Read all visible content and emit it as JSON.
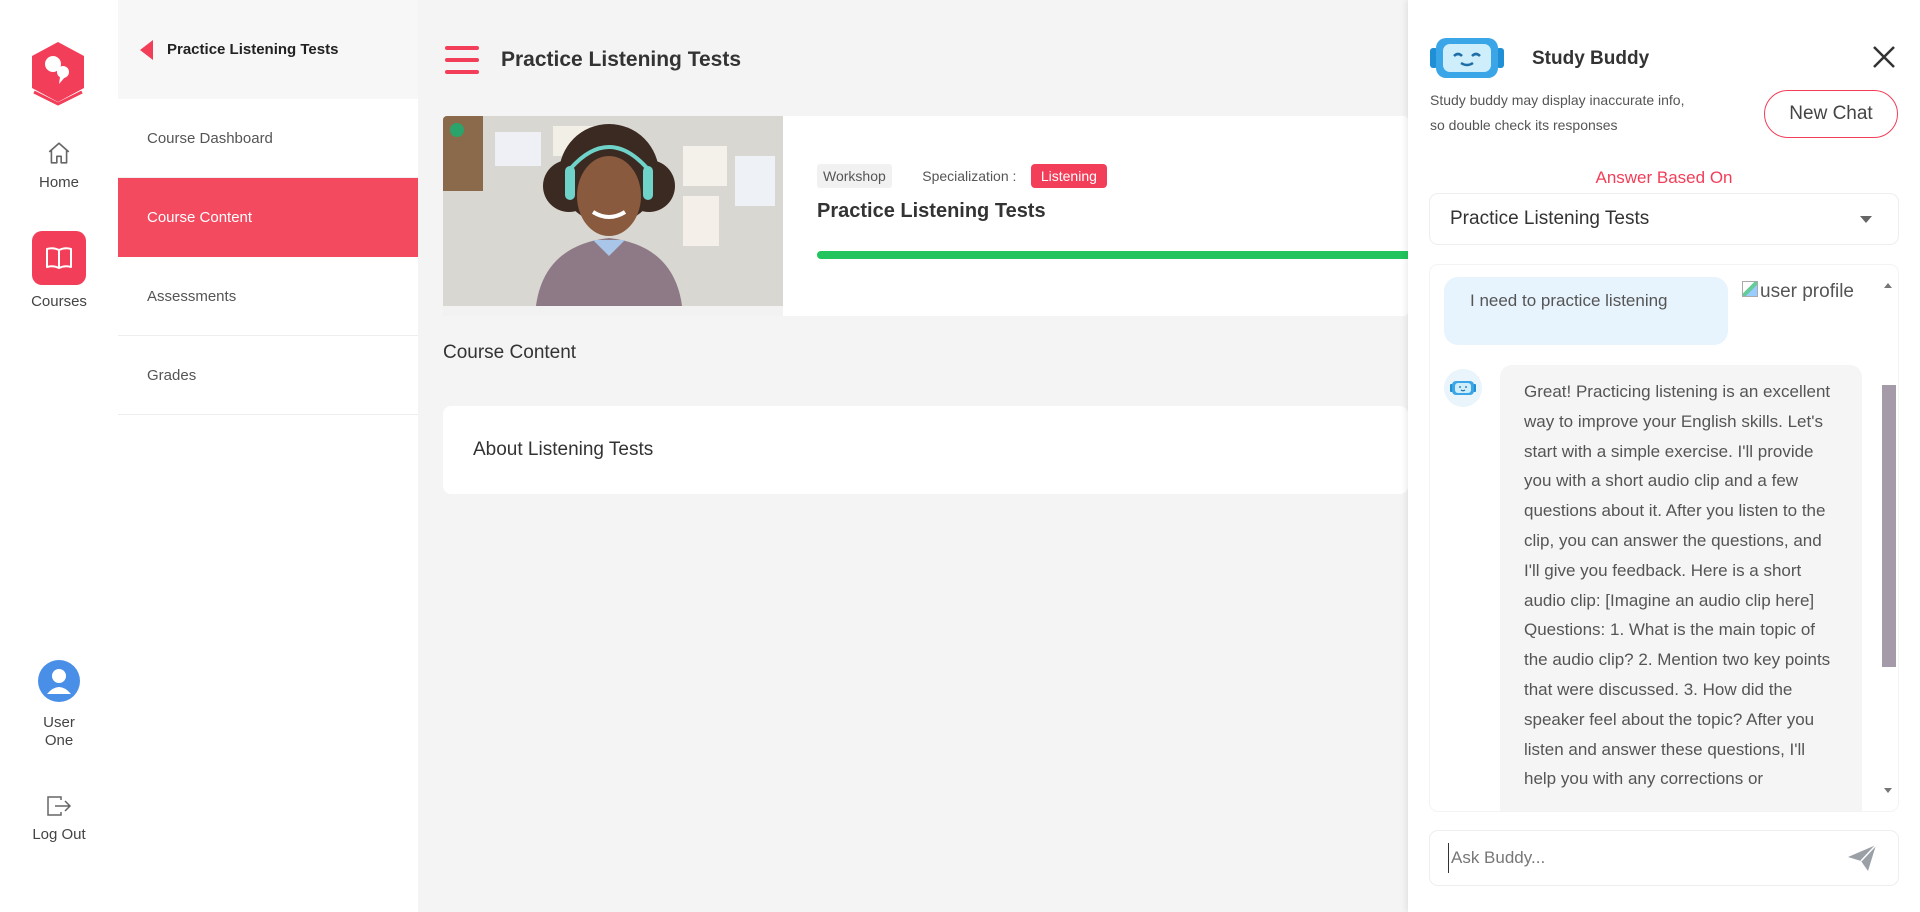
{
  "rail": {
    "home_label": "Home",
    "courses_label": "Courses",
    "user_label_line1": "User",
    "user_label_line2": "One",
    "logout_label": "Log Out",
    "accent": "#f23e58"
  },
  "sidebar": {
    "title": "Practice Listening Tests",
    "items": [
      {
        "label": "Course Dashboard",
        "active": false
      },
      {
        "label": "Course Content",
        "active": true
      },
      {
        "label": "Assessments",
        "active": false
      },
      {
        "label": "Grades",
        "active": false
      }
    ]
  },
  "main": {
    "page_title": "Practice Listening Tests",
    "course": {
      "tag": "Workshop",
      "specialization_label": "Specialization :",
      "specialization": "Listening",
      "title": "Practice Listening Tests",
      "progress_fraction": 1.0,
      "progress_color": "#22c45e"
    },
    "section_title": "Course Content",
    "about_title": "About Listening Tests"
  },
  "buddy": {
    "title": "Study Buddy",
    "disclaimer_line1": "Study buddy may display inaccurate info,",
    "disclaimer_line2": "so double check its responses",
    "new_chat_label": "New Chat",
    "answer_based_on": "Answer Based On",
    "selected_source": "Practice Listening Tests",
    "messages": {
      "user_text": "I need to practice listening",
      "user_image_alt": "user profile",
      "bot_text": "Great! Practicing listening is an excellent way to improve your English skills. Let's start with a simple exercise. I'll provide you with a short audio clip and a few questions about it. After you listen to the clip, you can answer the questions, and I'll give you feedback. Here is a short audio clip: [Imagine an audio clip here] Questions: 1. What is the main topic of the audio clip? 2. Mention two key points that were discussed. 3. How did the speaker feel about the topic? After you listen and answer these questions, I'll help you with any corrections or"
    },
    "input_placeholder": "Ask Buddy..."
  }
}
